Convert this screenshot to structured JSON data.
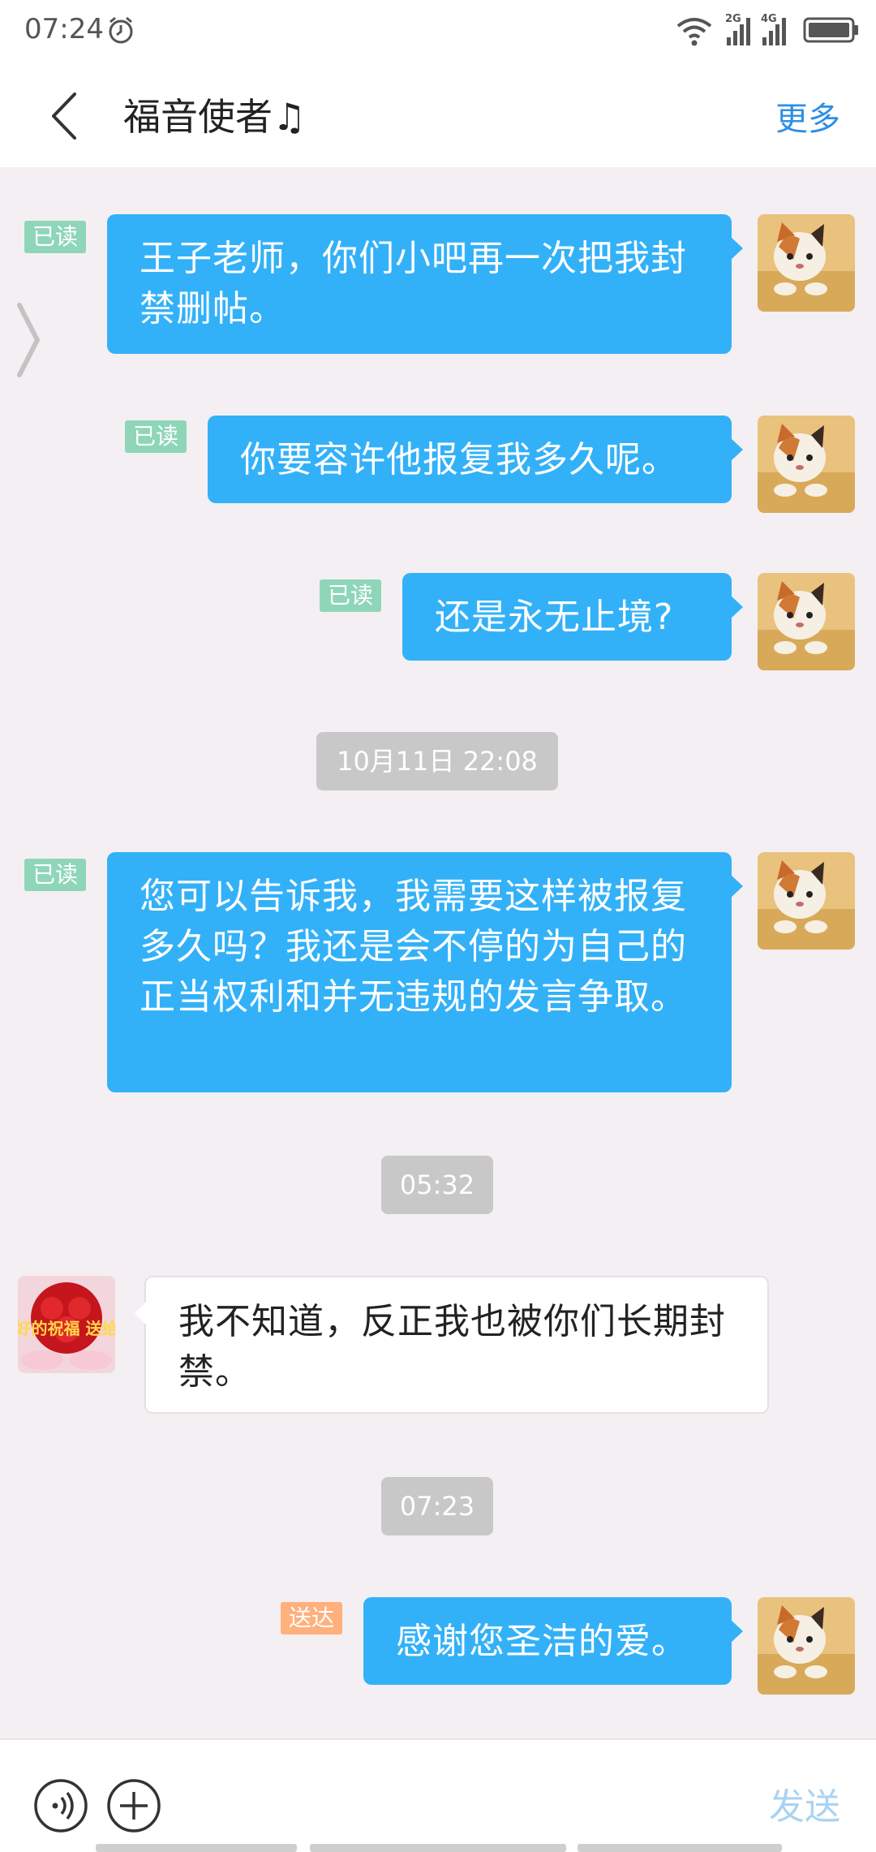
{
  "status_bar": {
    "time": "07:24",
    "signal_labels": [
      "2G",
      "4G"
    ],
    "icons": [
      "alarm-icon",
      "wifi-icon",
      "signal-2g-icon",
      "signal-4g-icon",
      "battery-icon"
    ]
  },
  "header": {
    "title": "福音使者♫",
    "more_label": "更多"
  },
  "messages": [
    {
      "direction": "out",
      "text": "王子老师，你们小吧再一次把我封禁删帖。",
      "status": "已读"
    },
    {
      "direction": "out",
      "text": "你要容许他报复我多久呢。",
      "status": "已读"
    },
    {
      "direction": "out",
      "text": "还是永无止境?",
      "status": "已读"
    },
    {
      "timestamp": "10月11日 22:08"
    },
    {
      "direction": "out",
      "text": "您可以告诉我，我需要这样被报复多久吗？我还是会不停的为自己的正当权利和并无违规的发言争取。",
      "status": "已读"
    },
    {
      "timestamp": "05:32"
    },
    {
      "direction": "in",
      "text": "我不知道，反正我也被你们长期封禁。"
    },
    {
      "timestamp": "07:23"
    },
    {
      "direction": "out",
      "text": "感谢您圣洁的爱。",
      "status": "送达"
    }
  ],
  "contact_avatar": {
    "text": "美好的祝福 送给你"
  },
  "input_bar": {
    "send_label": "发送"
  },
  "colors": {
    "outgoing_bubble": "#33b1f8",
    "read_badge": "#8fd6b9",
    "sent_badge": "#ffb07c",
    "accent": "#2d8ee6"
  }
}
